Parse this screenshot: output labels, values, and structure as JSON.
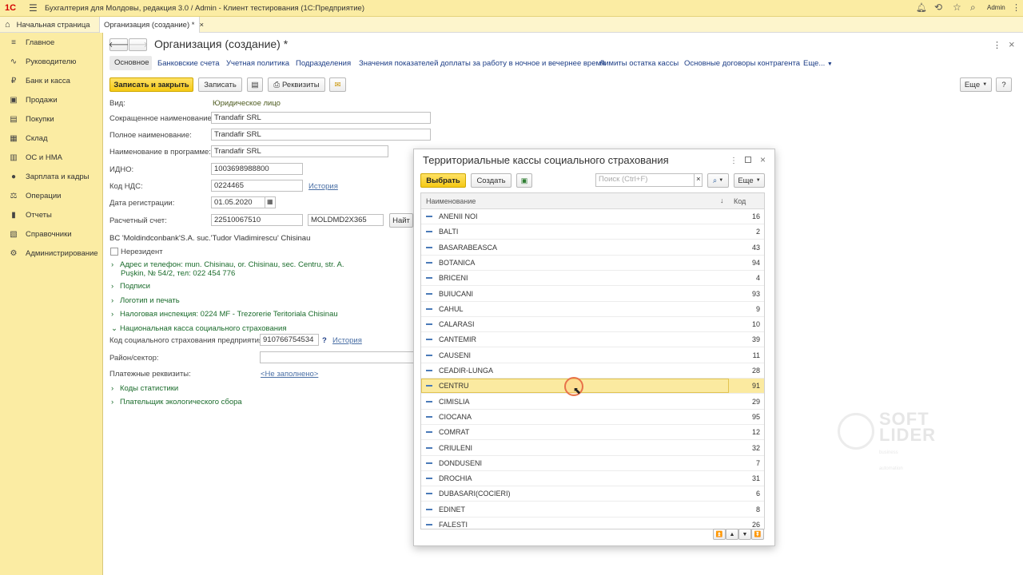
{
  "window": {
    "logo": "1С",
    "title": "Бухгалтерия для Молдовы, редакция 3.0 / Admin - Клиент тестирования (1С:Предприятие)",
    "user": "Admin"
  },
  "tabs": {
    "home": "Начальная страница",
    "active": "Организация (создание) *",
    "close": "×"
  },
  "sidebar": {
    "items": [
      {
        "label": "Главное",
        "icon": "≡"
      },
      {
        "label": "Руководителю",
        "icon": "∿"
      },
      {
        "label": "Банк и касса",
        "icon": "₽"
      },
      {
        "label": "Продажи",
        "icon": "▣"
      },
      {
        "label": "Покупки",
        "icon": "▤"
      },
      {
        "label": "Склад",
        "icon": "▦"
      },
      {
        "label": "ОС и НМА",
        "icon": "▥"
      },
      {
        "label": "Зарплата и кадры",
        "icon": "●"
      },
      {
        "label": "Операции",
        "icon": "⚖"
      },
      {
        "label": "Отчеты",
        "icon": "▮"
      },
      {
        "label": "Справочники",
        "icon": "▧"
      },
      {
        "label": "Администрирование",
        "icon": "⚙"
      }
    ]
  },
  "form": {
    "title": "Организация (создание) *",
    "nav_tabs": [
      "Основное",
      "Банковские счета",
      "Учетная политика",
      "Подразделения",
      "Значения показателей доплаты за работу в ночное и вечернее время",
      "Лимиты остатка кассы",
      "Основные договоры контрагента",
      "Еще..."
    ],
    "toolbar": {
      "save_close": "Записать и закрыть",
      "save": "Записать",
      "requisites": "Реквизиты",
      "more": "Еще",
      "help": "?"
    },
    "fields": {
      "vid_label": "Вид:",
      "vid_value": "Юридическое лицо",
      "short_name_label": "Сокращенное наименование:",
      "short_name": "Trandafir SRL",
      "full_name_label": "Полное наименование:",
      "full_name": "Trandafir SRL",
      "prog_name_label": "Наименование в программе:",
      "prog_name": "Trandafir SRL",
      "idno_label": "ИДНО:",
      "idno": "1003698988800",
      "vat_label": "Код НДС:",
      "vat": "0224465",
      "history": "История",
      "reg_date_label": "Дата регистрации:",
      "reg_date": "01.05.2020",
      "account_label": "Расчетный счет:",
      "account": "22510067510",
      "bic": "MOLDMD2X365",
      "find": "Найт",
      "bank_name": "BC 'Moldindconbank'S.A. suc.'Tudor Vladimirescu' Chisinau",
      "nonresident": "Нерезидент",
      "address_line1": "Адрес и телефон: mun. Chisinau, or. Chisinau, sec. Centru, str. A.",
      "address_line2": "Puşkin, № 54/2, тел: 022 454 776",
      "signatures": "Подписи",
      "logo_print": "Логотип и печать",
      "tax_office": "Налоговая инспекция: 0224 MF - Trezorerie Teritoriala Chisinau",
      "social_cash": "Национальная касса социального страхования",
      "social_code_label": "Код социального страхования предприятия:",
      "social_code": "910766754534",
      "question": "?",
      "history2": "История",
      "district_label": "Район/сектор:",
      "payment_label": "Платежные реквизиты:",
      "payment_value": "<Не заполнено>",
      "stat_codes": "Коды статистики",
      "eco_payer": "Плательщик экологического сбора"
    }
  },
  "dialog": {
    "title": "Территориальные кассы социального страхования",
    "select": "Выбрать",
    "create": "Создать",
    "search_placeholder": "Поиск (Ctrl+F)",
    "clear": "×",
    "more": "Еще",
    "col_name": "Наименование",
    "col_code": "Код",
    "rows": [
      {
        "name": "ANENII NOI",
        "code": "16"
      },
      {
        "name": "BALTI",
        "code": "2"
      },
      {
        "name": "BASARABEASCA",
        "code": "43"
      },
      {
        "name": "BOTANICA",
        "code": "94"
      },
      {
        "name": "BRICENI",
        "code": "4"
      },
      {
        "name": "BUIUCANI",
        "code": "93"
      },
      {
        "name": "CAHUL",
        "code": "9"
      },
      {
        "name": "CALARASI",
        "code": "10"
      },
      {
        "name": "CANTEMIR",
        "code": "39"
      },
      {
        "name": "CAUSENI",
        "code": "11"
      },
      {
        "name": "CEADIR-LUNGA",
        "code": "28"
      },
      {
        "name": "CENTRU",
        "code": "91",
        "selected": true
      },
      {
        "name": "CIMISLIA",
        "code": "29"
      },
      {
        "name": "CIOCANA",
        "code": "95"
      },
      {
        "name": "COMRAT",
        "code": "12"
      },
      {
        "name": "CRIULENI",
        "code": "32"
      },
      {
        "name": "DONDUSENI",
        "code": "7"
      },
      {
        "name": "DROCHIA",
        "code": "31"
      },
      {
        "name": "DUBASARI(COCIERI)",
        "code": "6"
      },
      {
        "name": "EDINET",
        "code": "8"
      },
      {
        "name": "FALESTI",
        "code": "26"
      }
    ]
  },
  "watermark": {
    "line1": "SOFT",
    "line2": "LIDER",
    "line3": "business automation"
  }
}
